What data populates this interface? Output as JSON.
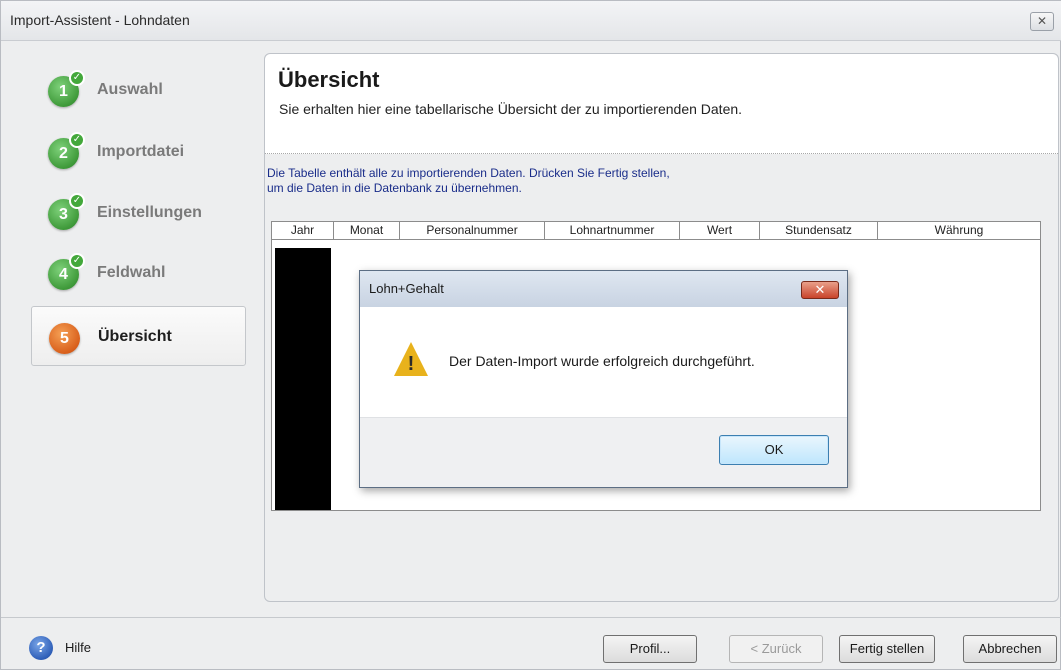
{
  "window": {
    "title": "Import-Assistent - Lohndaten",
    "close_symbol": "✕"
  },
  "steps": [
    {
      "number": "1",
      "label": "Auswahl",
      "done": true
    },
    {
      "number": "2",
      "label": "Importdatei",
      "done": true
    },
    {
      "number": "3",
      "label": "Einstellungen",
      "done": true
    },
    {
      "number": "4",
      "label": "Feldwahl",
      "done": true
    },
    {
      "number": "5",
      "label": "Übersicht",
      "done": false
    }
  ],
  "main": {
    "title": "Übersicht",
    "subtitle": "Sie erhalten hier eine tabellarische Übersicht der zu importierenden Daten.",
    "info_line1": "Die Tabelle enthält alle zu importierenden Daten. Drücken Sie Fertig stellen,",
    "info_line2": "um die Daten in die Datenbank zu übernehmen.",
    "table": {
      "columns": [
        "Jahr",
        "Monat",
        "Personalnummer",
        "Lohnartnummer",
        "Wert",
        "Stundensatz",
        "Währung"
      ]
    }
  },
  "dialog": {
    "title": "Lohn+Gehalt",
    "message": "Der Daten-Import wurde erfolgreich durchgeführt.",
    "ok_label": "OK",
    "close_symbol": "✕"
  },
  "footer": {
    "help_label": "Hilfe",
    "help_icon_text": "?",
    "profile_label": "Profil...",
    "back_label": "< Zurück",
    "finish_label": "Fertig stellen",
    "cancel_label": "Abbrechen"
  },
  "colors": {
    "step_done": "#3f9a3a",
    "step_active": "#d9601c",
    "info_text": "#1a2d8a"
  }
}
